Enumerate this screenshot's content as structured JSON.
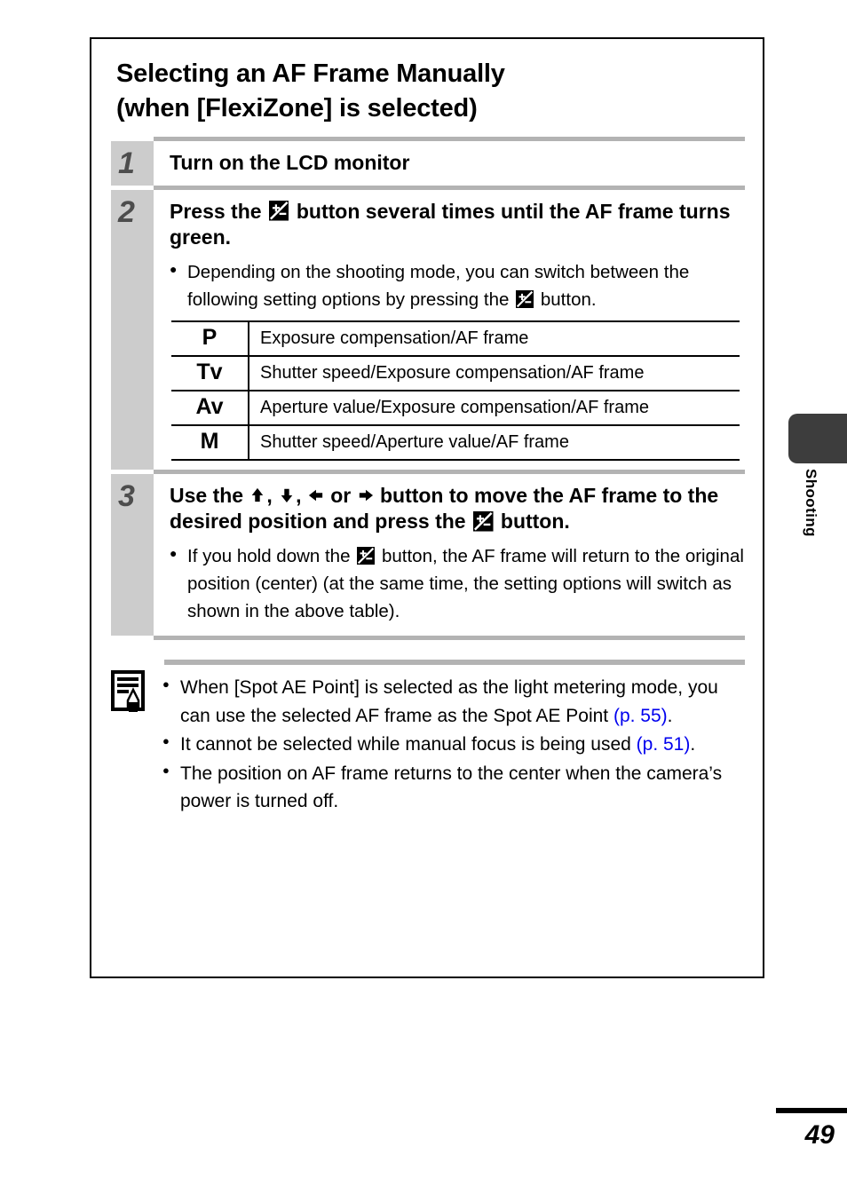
{
  "document": {
    "title_line1": "Selecting an AF Frame Manually",
    "title_line2": "(when [FlexiZone] is selected)",
    "title_full": "Selecting an AF Frame Manually\n(when [FlexiZone] is selected)"
  },
  "side_tab": {
    "label": "Shooting",
    "color": "#3d3d3d"
  },
  "footer": {
    "page_number": "49"
  },
  "steps": [
    {
      "number": "1",
      "heading": "Turn on the LCD monitor"
    },
    {
      "number": "2",
      "heading_part1": "Press the",
      "heading_icon": "exposure-compensation-icon",
      "heading_part2": "button several times until the AF frame turns green.",
      "bullets": [
        {
          "text_part1": "Depending on the shooting mode, you can switch between the following setting options by pressing the",
          "icon": "exposure-compensation-icon",
          "text_part2": "button."
        }
      ]
    },
    {
      "number": "3",
      "heading_part1": "Use the",
      "arrows": [
        "arrow-up-icon",
        "arrow-down-icon",
        "arrow-left-icon",
        "arrow-right-icon"
      ],
      "heading_sep1": ",",
      "heading_sep2": ",",
      "heading_or": "or",
      "heading_part2": "button to move the AF frame to the desired position and press the",
      "heading_icon": "exposure-compensation-icon",
      "heading_part3": "button.",
      "bullets": [
        {
          "text_part1": "If you hold down the",
          "icon": "exposure-compensation-icon",
          "text_part2": "button, the AF frame will return to the original position (center) (at the same time, the setting options will switch as shown in the above table)."
        }
      ]
    }
  ],
  "mode_table": {
    "rows": [
      {
        "mode": "P",
        "description": "Exposure compensation/AF frame"
      },
      {
        "mode": "Tv",
        "description": "Shutter speed/Exposure compensation/AF frame"
      },
      {
        "mode": "Av",
        "description": "Aperture value/Exposure compensation/AF frame"
      },
      {
        "mode": "M",
        "description": "Shutter speed/Aperture value/AF frame"
      }
    ]
  },
  "note": {
    "icon": "memo-note-icon",
    "bullets": [
      {
        "text_before": "When [Spot AE Point] is selected as the light metering mode, you can use the selected AF frame as the Spot AE Point ",
        "link": "(p. 55)",
        "text_after": "."
      },
      {
        "text_before": "It cannot be selected while manual focus is being used ",
        "link": "(p. 51)",
        "text_after": "."
      },
      {
        "text_before": "The position on AF frame returns to the center when the camera’s power is turned off.",
        "link": "",
        "text_after": ""
      }
    ]
  },
  "colors": {
    "link": "#0000ee",
    "step_number": "#4d4d4d",
    "step_column": "#cccccc",
    "separator": "#b3b3b3"
  }
}
